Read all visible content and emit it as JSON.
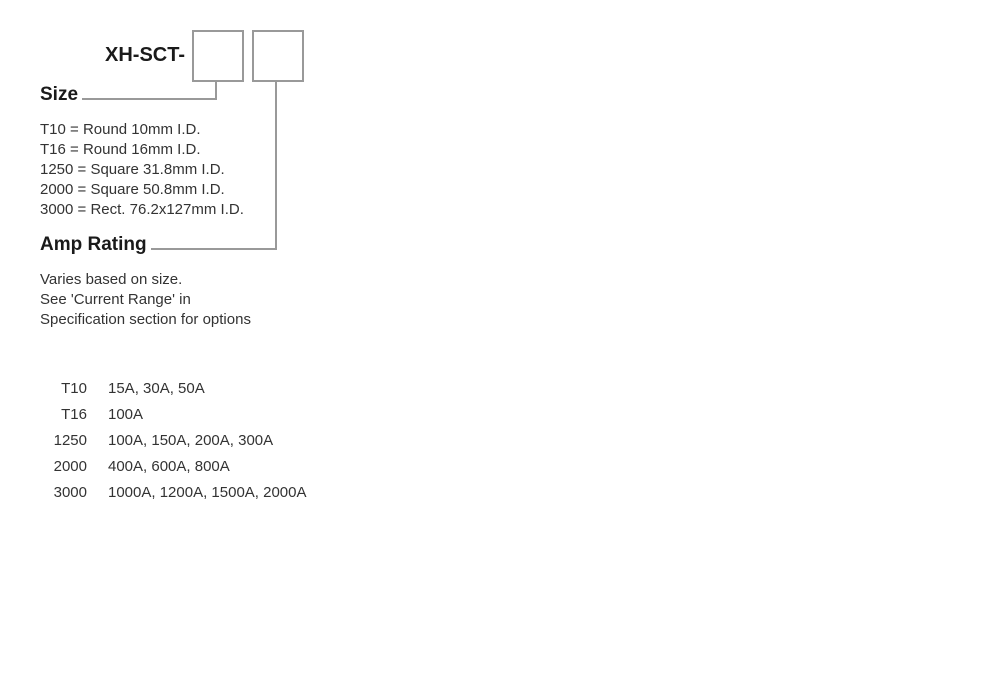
{
  "part_prefix": "XH-SCT-",
  "size": {
    "heading": "Size",
    "items": [
      "T10 = Round 10mm I.D.",
      "T16 = Round 16mm I.D.",
      "1250 = Square 31.8mm I.D.",
      "2000 = Square 50.8mm I.D.",
      "3000 = Rect. 76.2x127mm I.D."
    ]
  },
  "amp": {
    "heading": "Amp Rating",
    "lines": [
      "Varies based on size.",
      "See 'Current Range' in",
      "Specification section for options"
    ]
  },
  "ratings": [
    {
      "key": "T10",
      "vals": "15A, 30A, 50A"
    },
    {
      "key": "T16",
      "vals": "100A"
    },
    {
      "key": "1250",
      "vals": "100A, 150A, 200A, 300A"
    },
    {
      "key": "2000",
      "vals": "400A, 600A, 800A"
    },
    {
      "key": "3000",
      "vals": "1000A, 1200A, 1500A, 2000A"
    }
  ]
}
